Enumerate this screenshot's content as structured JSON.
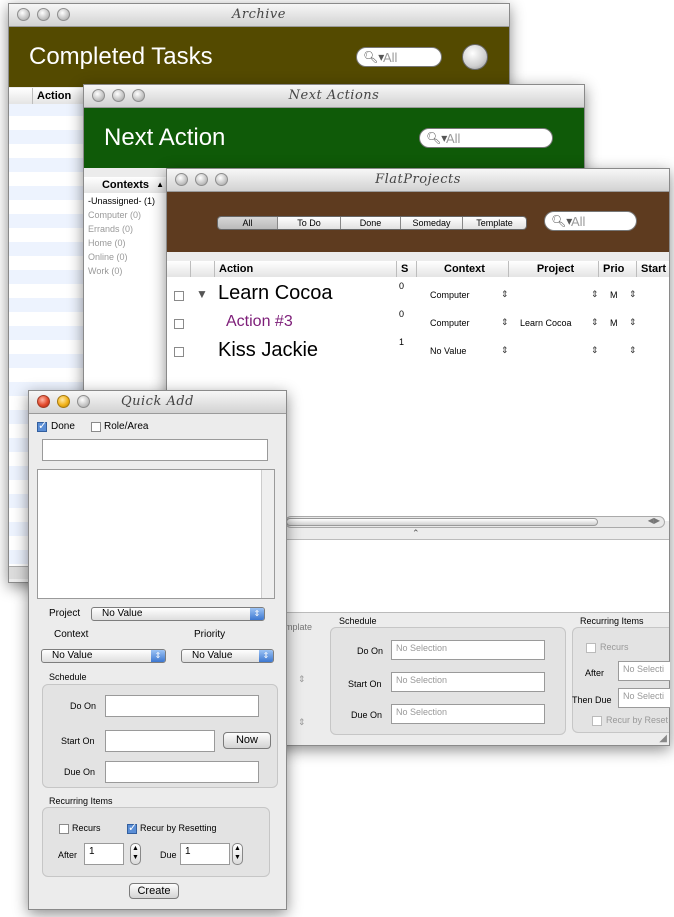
{
  "archive": {
    "title": "Archive",
    "banner_title": "Completed Tasks",
    "search_placeholder": "All",
    "column_action": "Action"
  },
  "next_actions": {
    "title": "Next Actions",
    "banner_title": "Next Action",
    "search_placeholder": "All",
    "contexts_header": "Contexts",
    "contexts": [
      "-Unassigned- (1)",
      "Computer (0)",
      "Errands (0)",
      "Home (0)",
      "Online (0)",
      "Work (0)"
    ]
  },
  "flat_projects": {
    "title": "FlatProjects",
    "filters": [
      "All",
      "To Do",
      "Done",
      "Someday",
      "Template"
    ],
    "search_placeholder": "All",
    "columns": [
      "Action",
      "S",
      "Context",
      "Project",
      "Prio",
      "Start"
    ],
    "rows": [
      {
        "action": "Learn Cocoa",
        "s": "0",
        "context": "Computer",
        "project": "",
        "prio": "M",
        "disclosure": "▼"
      },
      {
        "action": "Action #3",
        "s": "0",
        "context": "Computer",
        "project": "Learn Cocoa",
        "prio": "M",
        "disclosure": ""
      },
      {
        "action": "Kiss Jackie",
        "s": "1",
        "context": "No Value",
        "project": "",
        "prio": "",
        "disclosure": ""
      }
    ],
    "partial_label": "mplate",
    "schedule": {
      "title": "Schedule",
      "do_on_label": "Do On",
      "start_on_label": "Start On",
      "due_on_label": "Due On",
      "do_on_value": "No Selection",
      "start_on_value": "No Selection",
      "due_on_value": "No Selection"
    },
    "recurring": {
      "title": "Recurring Items",
      "recurs_label": "Recurs",
      "after_label": "After",
      "after_value": "No Selecti",
      "then_due_label": "Then Due",
      "then_due_value": "No Selecti",
      "recur_reset_label": "Recur by Reset"
    }
  },
  "quick_add": {
    "title": "Quick Add",
    "done_label": "Done",
    "done_checked": true,
    "role_label": "Role/Area",
    "role_checked": false,
    "project_label": "Project",
    "project_value": "No Value",
    "context_label": "Context",
    "context_value": "No Value",
    "priority_label": "Priority",
    "priority_value": "No Value",
    "schedule": {
      "title": "Schedule",
      "do_on_label": "Do On",
      "start_on_label": "Start On",
      "due_on_label": "Due On",
      "now_button": "Now"
    },
    "recurring": {
      "title": "Recurring Items",
      "recurs_label": "Recurs",
      "recurs_checked": false,
      "recur_reset_label": "Recur by Resetting",
      "recur_reset_checked": true,
      "after_label": "After",
      "after_value": "1",
      "due_label": "Due",
      "due_value": "1"
    },
    "create_button": "Create"
  },
  "colors": {
    "archive_banner": "#544a00",
    "next_banner": "#0f5a08",
    "flat_banner": "#5e3b1f",
    "action3_text": "#7d1d78"
  }
}
